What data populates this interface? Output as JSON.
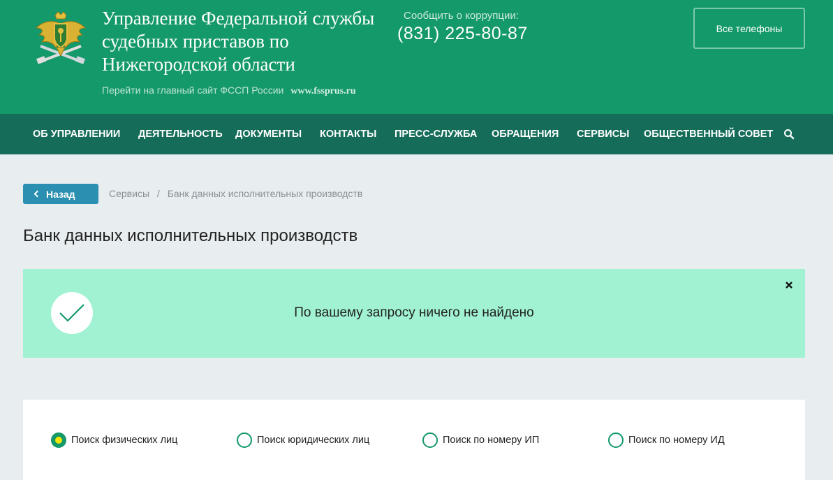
{
  "header": {
    "org_name": "Управление Федеральной службы судебных приставов по Нижегородской области",
    "main_site_text": "Перейти на главный сайт ФССП России",
    "main_site_url": "www.fssprus.ru",
    "corruption_label": "Сообщить о коррупции:",
    "corruption_phone": "(831) 225-80-87",
    "all_phones_label": "Все телефоны",
    "emblem_icon": "fssp-emblem-icon"
  },
  "nav": {
    "items": [
      "ОБ УПРАВЛЕНИИ",
      "ДЕЯТЕЛЬНОСТЬ",
      "ДОКУМЕНТЫ",
      "КОНТАКТЫ",
      "ПРЕСС-СЛУЖБА",
      "ОБРАЩЕНИЯ",
      "СЕРВИСЫ",
      "ОБЩЕСТВЕННЫЙ СОВЕТ"
    ],
    "search_icon": "search-icon"
  },
  "back_label": "Назад",
  "breadcrumb": {
    "items": [
      "Сервисы",
      "Банк данных исполнительных производств"
    ],
    "separator": "/"
  },
  "page_title": "Банк данных исполнительных производств",
  "alert": {
    "message": "По вашему запросу ничего не найдено",
    "icon": "check-icon",
    "close_icon": "close-icon"
  },
  "search_types": {
    "options": [
      "Поиск физических лиц",
      "Поиск юридических лиц",
      "Поиск по номеру ИП",
      "Поиск по номеру ИД"
    ],
    "selected_index": 0
  },
  "colors": {
    "header_bg": "#14996a",
    "nav_bg": "#156c59",
    "page_bg": "#e8edf0",
    "back_button": "#2a8fb0",
    "alert_bg": "#a0f2d2",
    "radio_selected_dot": "#f2e500"
  }
}
